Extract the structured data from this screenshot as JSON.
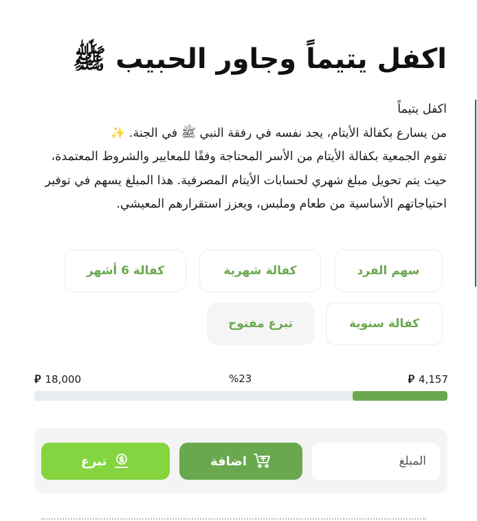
{
  "title": "اكفل يتيماً وجاور الحبيب ﷺ",
  "description": {
    "line1": "اكفل يتيماً",
    "line2": "من يسارع بكفالة الأيتام، يجد نفسه في رفقة النبي ﷺ في الجنة. ✨",
    "body": "تقوم الجمعية بكفالة الأيتام من الأسر المحتاجة وفقًا للمعايير والشروط المعتمدة، حيث يتم تحويل مبلغ شهري لحسابات الأيتام المصرفية. هذا المبلغ يسهم في توفير احتياجاتهم الأساسية من طعام وملبس، ويعزز استقرارهم المعيشي."
  },
  "options": [
    {
      "label": "سهم الفرد"
    },
    {
      "label": "كفالة شهرية"
    },
    {
      "label": "كفالة 6 أشهر"
    },
    {
      "label": "كفالة سنوية"
    },
    {
      "label": "تبرع مفتوح"
    }
  ],
  "progress": {
    "collected": "4,157",
    "target": "18,000",
    "percent_label": "%23",
    "fraction": 0.23,
    "currency_symbol": "⃁"
  },
  "donate_form": {
    "amount_placeholder": "المبلغ",
    "add_label": "اضافة",
    "donate_label": "تبرع"
  },
  "colors": {
    "accent_green": "#6aa84f",
    "light_green": "#84d540",
    "track": "#e8ecef"
  }
}
